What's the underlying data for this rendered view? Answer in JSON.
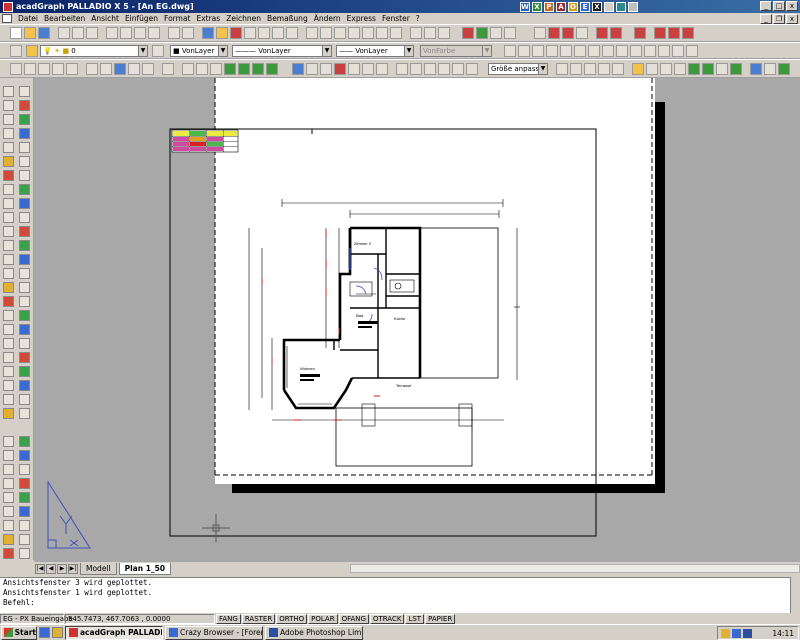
{
  "window": {
    "title": "acadGraph PALLADIO X 5 - [An EG.dwg]"
  },
  "title_tray_icons": [
    "W",
    "X",
    "P",
    "A",
    "O",
    "E",
    "X"
  ],
  "menu": [
    "Datei",
    "Bearbeiten",
    "Ansicht",
    "Einfügen",
    "Format",
    "Extras",
    "Zeichnen",
    "Bemaßung",
    "Ändern",
    "Express",
    "Fenster",
    "?"
  ],
  "properties_bar": {
    "layer": "0",
    "color": "VonLayer",
    "linetype": "VonLayer",
    "lineweight": "VonLayer",
    "plotstyle": "VonFarbe"
  },
  "zoom_combo": "Größe anpassen",
  "drawing": {
    "labels": {
      "room_zimmer": "Zimmer 3",
      "room_bad": "Bad",
      "room_kueche": "Küche",
      "room_wohnen": "Wohnen",
      "room_terrasse": "Terrasse"
    }
  },
  "layout_tabs": {
    "model": "Modell",
    "layout": "Plan 1_50"
  },
  "command_lines": [
    "Ansichtsfenster 3 wird geplottet.",
    "Ansichtsfenster 1 wird geplottet."
  ],
  "command_prompt": "Befehl:",
  "status": {
    "project": "EG - PX Baueingabe",
    "coords": "545.7473, 467.7063 , 0.0000",
    "toggles": [
      "FANG",
      "RASTER",
      "ORTHO",
      "POLAR",
      "OFANG",
      "OTRACK",
      "LST",
      "PAPIER"
    ]
  },
  "taskbar": {
    "start": "Start",
    "tasks": [
      "acadGraph PALLADIO ...",
      "Crazy Browser - [Foren a...",
      "Adobe Photoshop Limited ..."
    ],
    "clock": "14:11"
  }
}
